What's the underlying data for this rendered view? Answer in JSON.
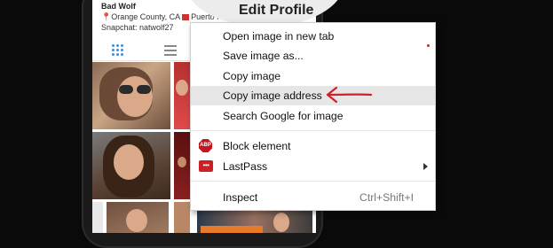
{
  "profile": {
    "name": "Bad Wolf",
    "location": "Orange County, CA",
    "second_location": "Puerto R",
    "snapchat": "Snapchat: natwolf27"
  },
  "header": {
    "edit_profile_label": "Edit Profile"
  },
  "context_menu": {
    "open_new_tab": "Open image in new tab",
    "save_as": "Save image as...",
    "copy_image": "Copy image",
    "copy_address": "Copy image address",
    "search_google": "Search Google for image",
    "block_element": "Block element",
    "lastpass": "LastPass",
    "inspect": "Inspect",
    "inspect_shortcut": "Ctrl+Shift+I"
  },
  "icons": {
    "abp": "ABP",
    "lastpass": "•••"
  },
  "colors": {
    "highlight": "#e6e6e6",
    "annotation_arrow": "#d0202a",
    "grid_icon_active": "#3a8ee6"
  }
}
